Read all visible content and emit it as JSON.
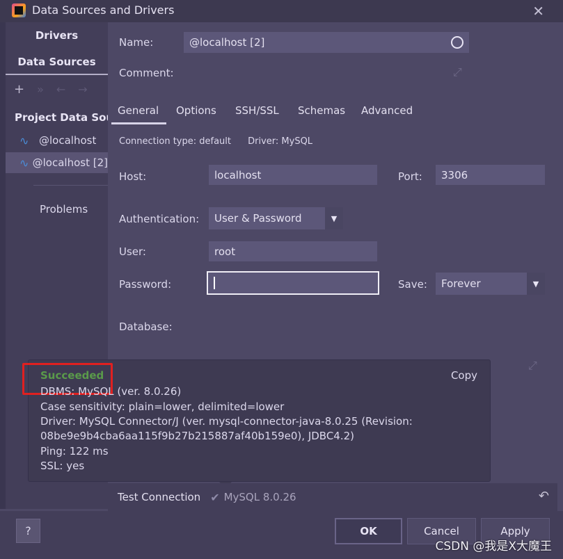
{
  "window": {
    "title": "Data Sources and Drivers",
    "close_glyph": "✕"
  },
  "left_nav": {
    "drivers": "Drivers",
    "data_sources": "Data Sources",
    "section": "Project Data Sources",
    "items": [
      {
        "label": "@localhost",
        "selected": false
      },
      {
        "label": "@localhost [2]",
        "selected": true
      }
    ],
    "problems": "Problems"
  },
  "form": {
    "name_label": "Name:",
    "name_value": "@localhost [2]",
    "comment_label": "Comment:",
    "tabs": [
      "General",
      "Options",
      "SSH/SSL",
      "Schemas",
      "Advanced"
    ],
    "active_tab": "General",
    "connection_type": "Connection type: default",
    "driver": "Driver: MySQL",
    "host_label": "Host:",
    "host_value": "localhost",
    "port_label": "Port:",
    "port_value": "3306",
    "auth_label": "Authentication:",
    "auth_value": "User & Password",
    "user_label": "User:",
    "user_value": "root",
    "password_label": "Password:",
    "password_value": "",
    "save_label": "Save:",
    "save_value": "Forever",
    "database_label": "Database:"
  },
  "popup": {
    "status": "Succeeded",
    "copy": "Copy",
    "lines": [
      "DBMS: MySQL (ver. 8.0.26)",
      "Case sensitivity: plain=lower, delimited=lower",
      "Driver: MySQL Connector/J (ver. mysql-connector-java-8.0.25 (Revision:",
      "08be9e9b4cba6aa115f9b27b215887af40b159e0), JDBC4.2)",
      "Ping: 122 ms",
      "SSL: yes"
    ]
  },
  "test_connection": {
    "label": "Test Connection",
    "status": "MySQL 8.0.26"
  },
  "footer": {
    "help": "?",
    "ok": "OK",
    "cancel": "Cancel",
    "apply": "Apply"
  },
  "watermark": "CSDN @我是X大魔王",
  "colors": {
    "success": "#5a9a4a",
    "highlight_box": "#e02020",
    "accent_icon": "#4b8dd8"
  }
}
